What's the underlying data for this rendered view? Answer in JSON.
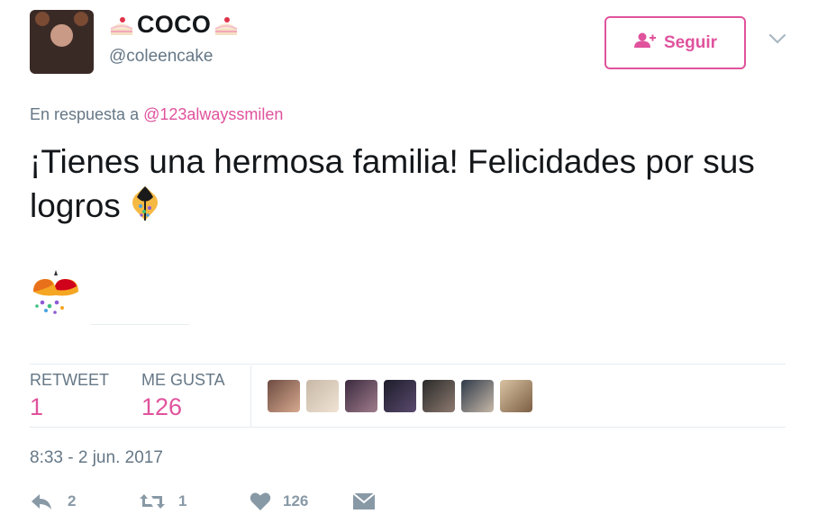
{
  "author": {
    "display_name": "COCO",
    "handle": "@coleencake",
    "avatar_icon": "profile-photo",
    "name_emoji": "cake-slice-icon"
  },
  "follow_button": {
    "label": "Seguir",
    "icon": "add-user-icon"
  },
  "reply": {
    "prefix": "En respuesta a",
    "mention": "@123alwayssmilen"
  },
  "tweet": {
    "text": "¡Tienes una hermosa familia! Felicidades por sus logros",
    "inline_emoji": "party-popper-icon",
    "trailing_emoji": "confetti-ball-icon"
  },
  "stats": {
    "retweet_label": "RETWEET",
    "retweet_count": "1",
    "like_label": "ME GUSTA",
    "like_count": "126"
  },
  "likers": [
    {
      "colors": [
        "#6d4c41",
        "#d7a98f"
      ]
    },
    {
      "colors": [
        "#c8b8a6",
        "#efe3d4"
      ]
    },
    {
      "colors": [
        "#3b2a3f",
        "#a07c8c"
      ]
    },
    {
      "colors": [
        "#1d1d2a",
        "#5a4a6e"
      ]
    },
    {
      "colors": [
        "#2a2a2a",
        "#8d7a70"
      ]
    },
    {
      "colors": [
        "#2f3a4a",
        "#c7b9a8"
      ]
    },
    {
      "colors": [
        "#d9c3a3",
        "#7c5e44"
      ]
    }
  ],
  "timestamp": "8:33 - 2 jun. 2017",
  "actions": {
    "reply_count": "2",
    "retweet_count": "1",
    "like_count": "126"
  },
  "colors": {
    "accent": "#e0539d",
    "muted": "#657786",
    "action_gray": "#8899a6"
  }
}
